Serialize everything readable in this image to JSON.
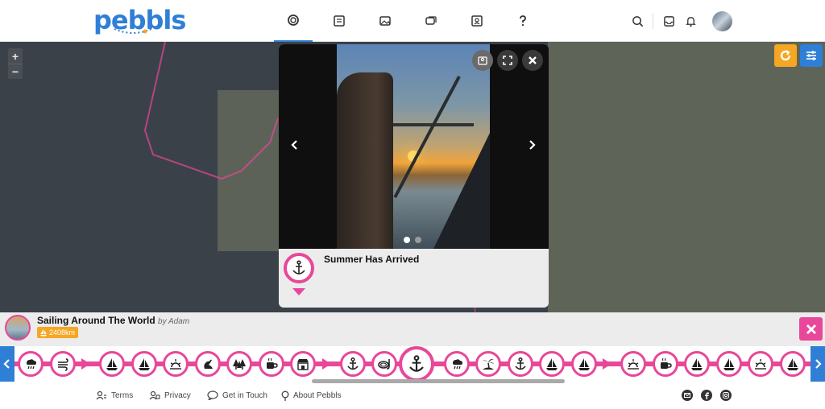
{
  "header": {
    "logo_text": "pebbls",
    "nav": [
      {
        "icon": "circle-icon"
      },
      {
        "icon": "journal-icon"
      },
      {
        "icon": "photos-icon"
      },
      {
        "icon": "chat-icon"
      },
      {
        "icon": "contact-card-icon"
      },
      {
        "icon": "help-icon"
      }
    ],
    "right_icons": [
      "search-icon",
      "inbox-icon",
      "bell-icon",
      "avatar"
    ]
  },
  "map": {
    "zoom_in": "+",
    "zoom_out": "−",
    "buttons": [
      "refresh-icon",
      "filter-sliders-icon"
    ]
  },
  "popup": {
    "title": "Summer Has Arrived",
    "pin_icon": "anchor-icon",
    "slides_total": 2,
    "slide_active": 1
  },
  "trip": {
    "title": "Sailing Around The World",
    "by": "by Adam",
    "distance": "2408km"
  },
  "timeline": {
    "items": [
      "rain-icon",
      "wind-icon",
      "arrow",
      "sailboat-icon",
      "sailboat-icon",
      "sunrise-icon",
      "seal-icon",
      "forest-icon",
      "coffee-icon",
      "shop-icon",
      "arrow",
      "anchor-icon",
      "snorkel-icon",
      "anchor-icon",
      "rain-icon",
      "island-icon",
      "anchor-icon",
      "sailboat-icon",
      "sailboat-icon",
      "arrow",
      "sunrise-icon",
      "coffee-icon",
      "sailboat-icon",
      "sailboat-icon",
      "sunrise-icon",
      "sailboat-icon"
    ],
    "selected_index": 13
  },
  "footer": {
    "links": [
      {
        "label": "Terms",
        "icon": "terms-icon"
      },
      {
        "label": "Privacy",
        "icon": "privacy-icon"
      },
      {
        "label": "Get in Touch",
        "icon": "speech-bubble-icon"
      },
      {
        "label": "About Pebbls",
        "icon": "pin-icon"
      }
    ],
    "social": [
      "email-icon",
      "facebook-icon",
      "instagram-icon"
    ]
  },
  "colors": {
    "brand_blue": "#2f7fd6",
    "accent_pink": "#e8479a",
    "accent_orange": "#f5a623"
  }
}
